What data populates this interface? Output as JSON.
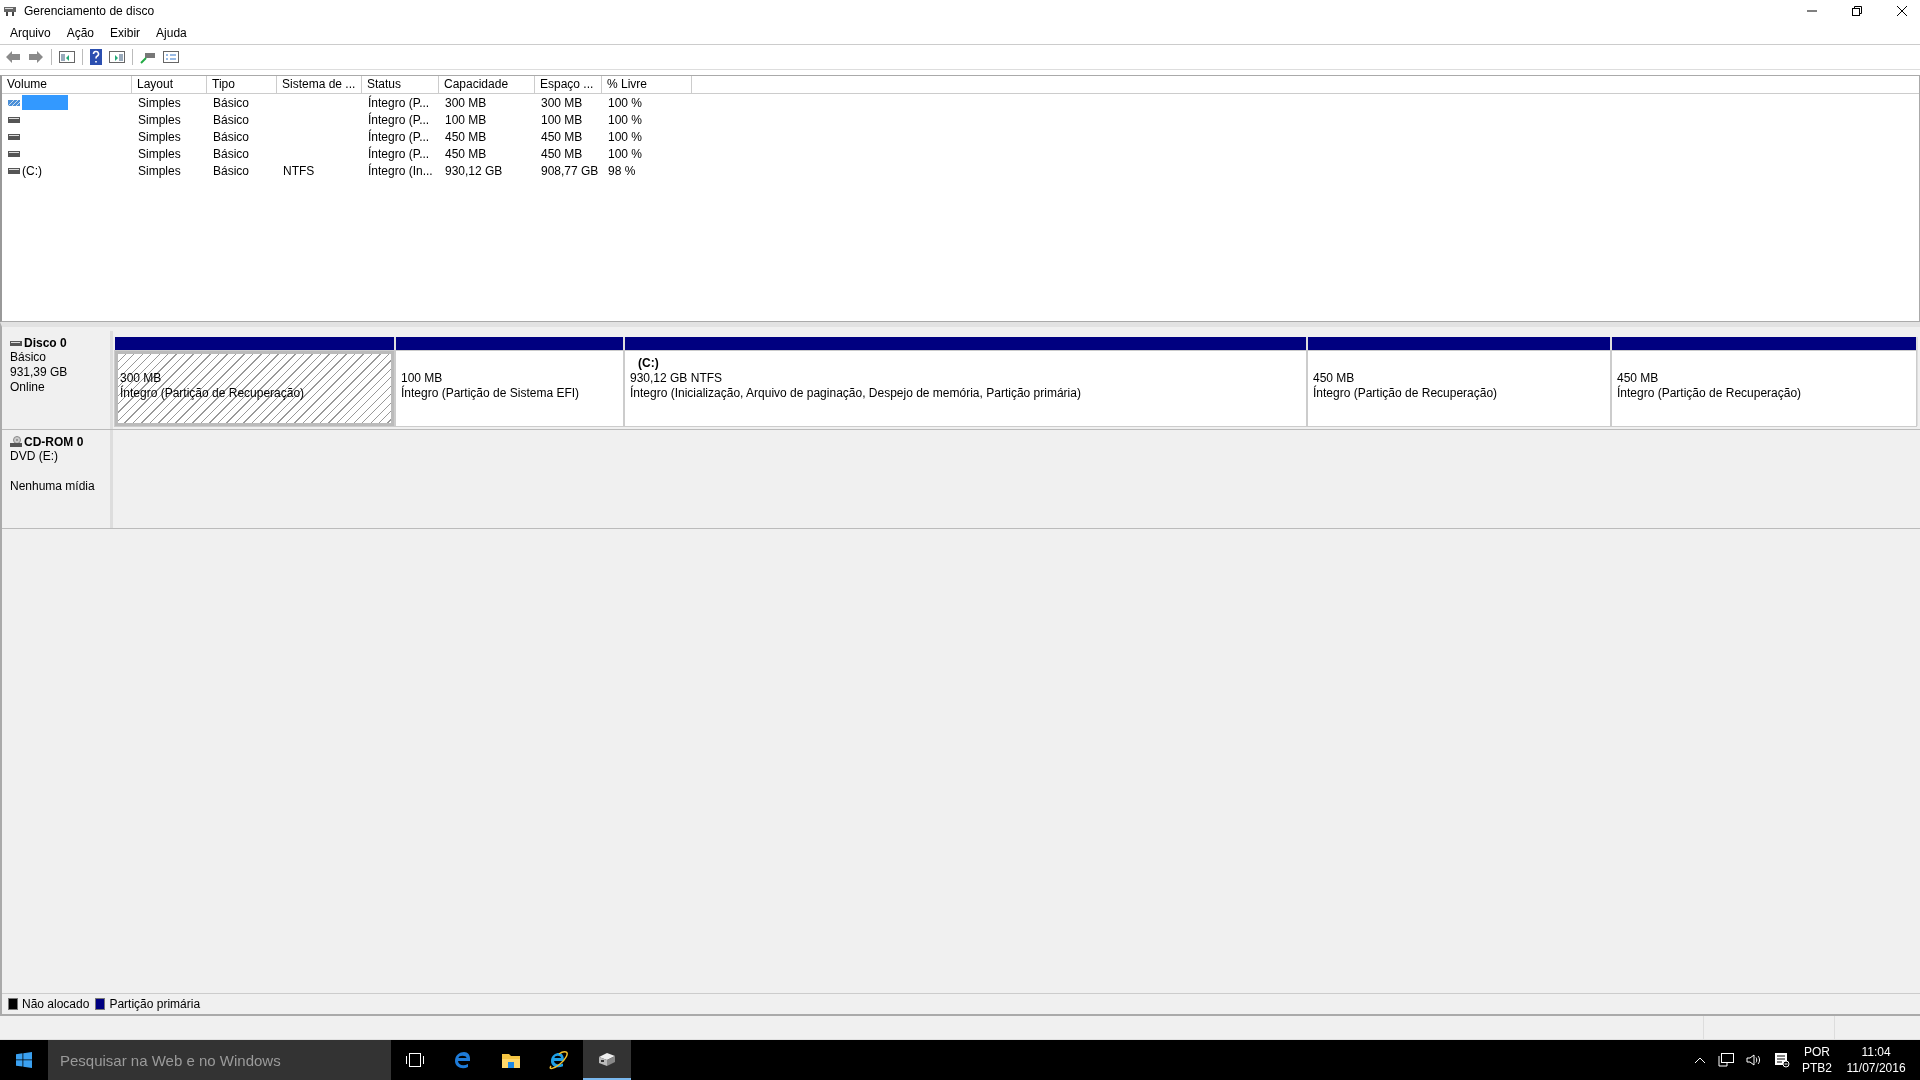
{
  "window": {
    "title": "Gerenciamento de disco"
  },
  "menu": [
    "Arquivo",
    "Ação",
    "Exibir",
    "Ajuda"
  ],
  "table": {
    "columns": [
      "Volume",
      "Layout",
      "Tipo",
      "Sistema de ...",
      "Status",
      "Capacidade",
      "Espaço ...",
      "% Livre"
    ],
    "rows": [
      {
        "selected": true,
        "cells": [
          "",
          "Simples",
          "Básico",
          "",
          "Íntegro (P...",
          "300 MB",
          "300 MB",
          "100 %"
        ]
      },
      {
        "selected": false,
        "cells": [
          "",
          "Simples",
          "Básico",
          "",
          "Íntegro (P...",
          "100 MB",
          "100 MB",
          "100 %"
        ]
      },
      {
        "selected": false,
        "cells": [
          "",
          "Simples",
          "Básico",
          "",
          "Íntegro (P...",
          "450 MB",
          "450 MB",
          "100 %"
        ]
      },
      {
        "selected": false,
        "cells": [
          "",
          "Simples",
          "Básico",
          "",
          "Íntegro (P...",
          "450 MB",
          "450 MB",
          "100 %"
        ]
      },
      {
        "selected": false,
        "cells": [
          "(C:)",
          "Simples",
          "Básico",
          "NTFS",
          "Íntegro (In...",
          "930,12 GB",
          "908,77 GB",
          "98 %"
        ]
      }
    ]
  },
  "disks": [
    {
      "kind": "disk",
      "name": "Disco 0",
      "lines": [
        "Básico",
        "931,39 GB"
      ],
      "status": "Online",
      "partitions": [
        {
          "selected": true,
          "size": "300 MB",
          "status": "Íntegro (Partição de Recuperação)"
        },
        {
          "selected": false,
          "size": "100 MB",
          "status": "Íntegro (Partição de Sistema EFI)"
        },
        {
          "selected": false,
          "label": "(C:)",
          "size": "930,12 GB NTFS",
          "status": "Íntegro (Inicialização, Arquivo de paginação, Despejo de memória, Partição primária)"
        },
        {
          "selected": false,
          "size": "450 MB",
          "status": "Íntegro (Partição de Recuperação)"
        },
        {
          "selected": false,
          "size": "450 MB",
          "status": "Íntegro (Partição de Recuperação)"
        }
      ]
    },
    {
      "kind": "cdrom",
      "name": "CD-ROM 0",
      "lines": [
        "DVD (E:)"
      ],
      "status": "Nenhuma mídia"
    }
  ],
  "legend": [
    {
      "label": "Não alocado",
      "color": "#000000"
    },
    {
      "label": "Partição primária",
      "color": "#000080"
    }
  ],
  "taskbar": {
    "search": {
      "placeholder": "Pesquisar na Web e no Windows"
    },
    "apps": [
      {
        "kind": "taskview",
        "selected": false
      },
      {
        "kind": "edge",
        "selected": false
      },
      {
        "kind": "explorer",
        "selected": false
      },
      {
        "kind": "ie",
        "selected": false
      },
      {
        "kind": "diskmgmt",
        "selected": true
      }
    ],
    "language": [
      "POR",
      "PTB2"
    ],
    "time": "11:04",
    "date": "11/07/2016"
  }
}
